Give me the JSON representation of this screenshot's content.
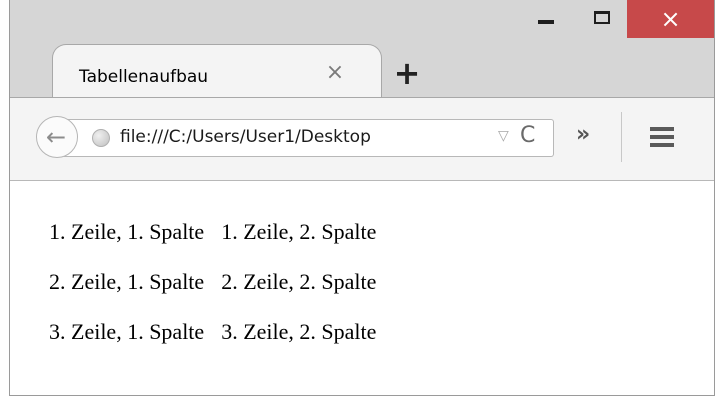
{
  "window": {
    "minimize_label": "minimize",
    "maximize_label": "maximize",
    "close_glyph": "×"
  },
  "tab": {
    "title": "Tabellenaufbau",
    "close_glyph": "×",
    "new_tab_glyph": "+"
  },
  "navbar": {
    "back_glyph": "←",
    "url": "file:///C:/Users/User1/Desktop",
    "dropdown_glyph": "▽",
    "reload_glyph": "C",
    "overflow_glyph": "»"
  },
  "icons": {
    "back": "back-arrow-icon",
    "globe": "globe-icon",
    "menu": "hamburger-menu-icon"
  },
  "table": {
    "rows": [
      [
        "1. Zeile, 1. Spalte",
        "1. Zeile, 2. Spalte"
      ],
      [
        "2. Zeile, 1. Spalte",
        "2. Zeile, 2. Spalte"
      ],
      [
        "3. Zeile, 1. Spalte",
        "3. Zeile, 2. Spalte"
      ]
    ]
  },
  "colors": {
    "titlebar": "#d6d6d6",
    "close_button": "#c7494a",
    "toolbar": "#f4f4f4"
  }
}
